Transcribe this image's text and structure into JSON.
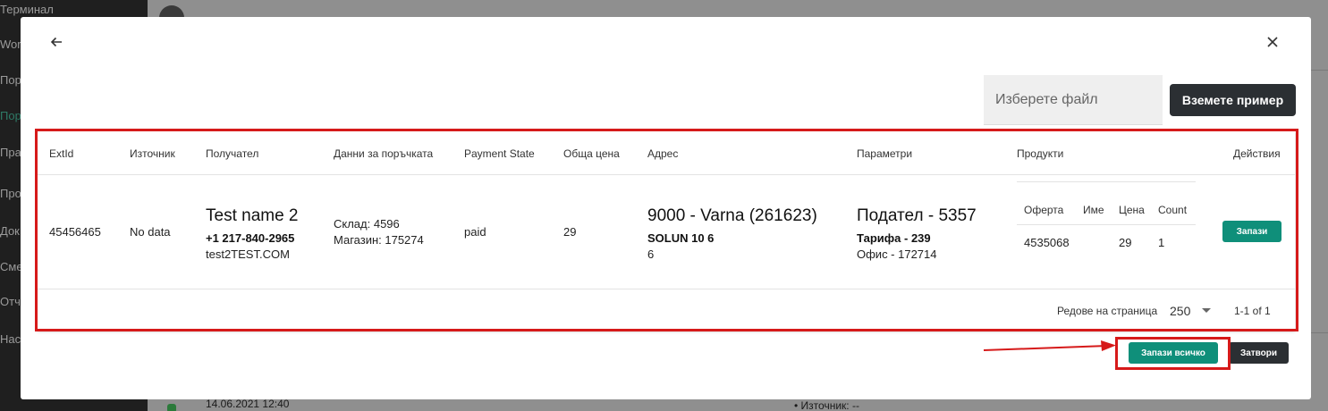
{
  "background": {
    "sidebar_items": [
      "Терминал",
      "Wor",
      "Пор",
      "Порт",
      "Прат",
      "Прод",
      "Док",
      "Сме",
      "Отче",
      "Нас"
    ],
    "date_text": "14.06.2021 12:40",
    "source_text": "Източник: --"
  },
  "modal": {
    "file_placeholder": "Изберете файл",
    "example_button": "Вземете пример",
    "table": {
      "columns": [
        "ExtId",
        "Източник",
        "Получател",
        "Данни за поръчката",
        "Payment State",
        "Обща цена",
        "Адрес",
        "Параметри",
        "Продукти",
        "Действия"
      ],
      "rows": [
        {
          "ext_id": "45456465",
          "source": "No data",
          "recipient_name": "Test name 2",
          "recipient_phone": "+1 217-840-2965",
          "recipient_email": "test2TEST.COM",
          "order_warehouse": "Склад: 4596",
          "order_shop": "Магазин: 175274",
          "payment_state": "paid",
          "total_price": "29",
          "address_city": "9000 - Varna (261623)",
          "address_street": "SOLUN 10 6",
          "address_extra": "6",
          "sender": "Подател - 5357",
          "tariff": "Тарифа - 239",
          "office": "Офис - 172714",
          "products": {
            "columns": [
              "Оферта",
              "Име",
              "Цена",
              "Count"
            ],
            "rows": [
              {
                "offer": "4535068",
                "name": "",
                "price": "29",
                "count": "1"
              }
            ]
          },
          "action_label": "Запази"
        }
      ],
      "rows_per_page_label": "Редове на страница",
      "rows_per_page": "250",
      "range_text": "1-1 of 1"
    },
    "save_all_label": "Запази всичко",
    "close_label": "Затвори"
  },
  "colors": {
    "primary": "#0f8f7a",
    "dark_button": "#2b2f33",
    "highlight": "#d61a1a"
  }
}
